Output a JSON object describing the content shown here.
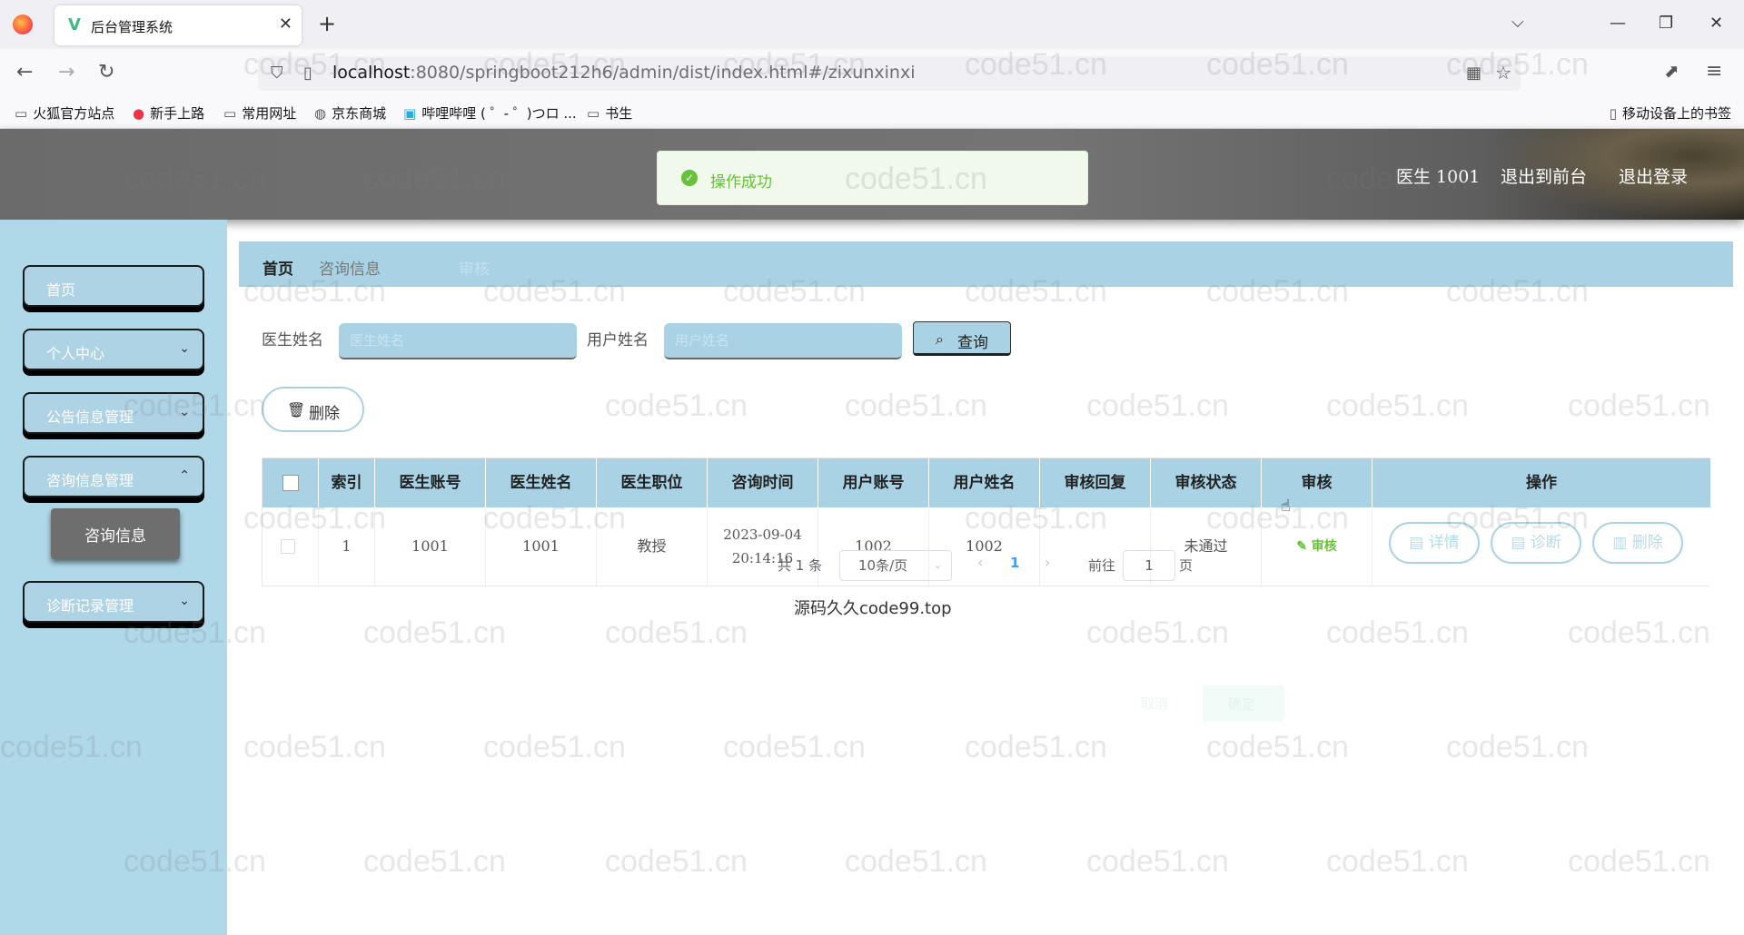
{
  "browser": {
    "tab_title": "后台管理系统",
    "url_host": "localhost",
    "url_rest": ":8080/springboot212h6/admin/dist/index.html#/zixunxinxi",
    "bookmarks": [
      "火狐官方站点",
      "新手上路",
      "常用网址",
      "京东商城",
      "哔哩哔哩 ( ゜- ゜)つロ ...",
      "书生"
    ],
    "mobile_bookmarks": "移动设备上的书签"
  },
  "header": {
    "user": "医生 1001",
    "back_to_front": "退出到前台",
    "logout": "退出登录"
  },
  "toast": {
    "message": "操作成功"
  },
  "sidebar": {
    "items": [
      {
        "label": "首页"
      },
      {
        "label": "个人中心"
      },
      {
        "label": "公告信息管理"
      },
      {
        "label": "咨询信息管理"
      },
      {
        "label": "诊断记录管理"
      }
    ],
    "active_sub": "咨询信息"
  },
  "breadcrumb": {
    "home": "首页",
    "current": "咨询信息",
    "faded": "审核"
  },
  "search": {
    "doctor_name_label": "医生姓名",
    "doctor_name_placeholder": "医生姓名",
    "user_name_label": "用户姓名",
    "user_name_placeholder": "用户姓名",
    "query_label": "查询"
  },
  "actions": {
    "delete_label": "删除"
  },
  "table": {
    "headers": [
      "索引",
      "医生账号",
      "医生姓名",
      "医生职位",
      "咨询时间",
      "用户账号",
      "用户姓名",
      "审核回复",
      "审核状态",
      "审核",
      "操作"
    ],
    "rows": [
      {
        "index": "1",
        "doctor_account": "1001",
        "doctor_name": "1001",
        "doctor_title": "教授",
        "consult_time": "2023-09-04 20:14:16",
        "user_account": "1002",
        "user_name": "1002",
        "audit_reply": "",
        "audit_status": "未通过",
        "audit_action": "审核",
        "ops": [
          "详情",
          "诊断",
          "删除"
        ]
      }
    ]
  },
  "pagination": {
    "total": "共 1 条",
    "page_size": "10条/页",
    "current_page": "1",
    "goto_prefix": "前往",
    "goto_value": "1",
    "goto_suffix": "页"
  },
  "ghost_dialog": {
    "cancel": "取消",
    "confirm": "确定"
  },
  "overlay_text": "源码久久code99.top",
  "watermark_text": "code51.cn",
  "colors": {
    "accent": "#a9d3e4",
    "success": "#67c23a",
    "sidebar": "#afd8e8"
  }
}
